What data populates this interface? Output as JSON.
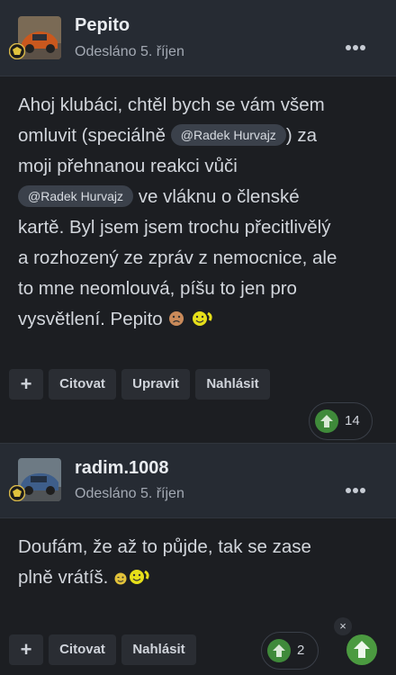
{
  "posts": [
    {
      "author": "Pepito",
      "posted": "Odesláno 5. říjen",
      "body": {
        "line1": "Ahoj klubáci, chtěl bych se vám všem",
        "line2a": "omluvit (speciálně",
        "mention1": "@Radek Hurvajz",
        "line2b": ") za",
        "line3": "moji přehnanou reakci vůči",
        "mention2": "@Radek Hurvajz",
        "line4b": "ve vláknu o členské",
        "line5": "kartě. Byl jsem jsem trochu přecitlivělý",
        "line6": "a rozhozený ze zpráv z nemocnice, ale",
        "line7": "to mne neomlouvá, píšu to jen pro",
        "line8": "vysvětlení. Pepito"
      },
      "actions": {
        "quote": "Citovat",
        "edit": "Upravit",
        "report": "Nahlásit"
      },
      "reaction_count": "14"
    },
    {
      "author": "radim.1008",
      "posted": "Odesláno 5. říjen",
      "body": {
        "line1": "Doufám, že až to půjde, tak se zase",
        "line2": "plně vrátíš."
      },
      "actions": {
        "quote": "Citovat",
        "report": "Nahlásit"
      },
      "reaction_count": "2"
    }
  ],
  "icons": {
    "plus": "+",
    "close": "×",
    "more": "ellipsis-icon",
    "reaction": "upvote-arrow-icon"
  },
  "colors": {
    "background": "#1c1e22",
    "header": "#262b33",
    "reaction_green": "#3f8a3a"
  }
}
